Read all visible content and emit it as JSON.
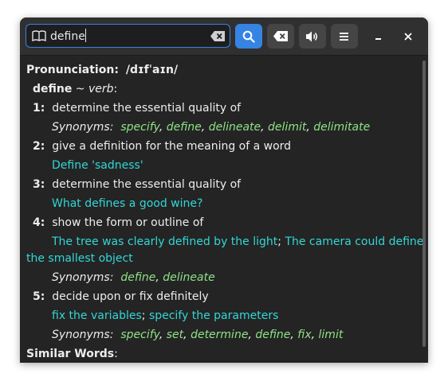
{
  "search": {
    "value": "define"
  },
  "pron": {
    "label": "Pronunciation",
    "text": "/dɪfˈaɪn/"
  },
  "entry": {
    "word": "define",
    "sep": " ~ ",
    "pos": "verb"
  },
  "colon": ":",
  "comma": ", ",
  "semicolon": "; ",
  "synonyms_label": "Synonyms:",
  "senses": [
    {
      "num": "1:",
      "text": "determine the essential quality of",
      "synonyms": [
        "specify",
        "define",
        "delineate",
        "delimit",
        "delimitate"
      ]
    },
    {
      "num": "2:",
      "text": "give a definition for the meaning of a word",
      "example": "Define 'sadness'"
    },
    {
      "num": "3:",
      "text": "determine the essential quality of",
      "example": "What defines a good wine?"
    },
    {
      "num": "4:",
      "text": "show the form or outline of",
      "examples": [
        "The tree was clearly defined by the light",
        "The camera could define",
        "the smallest object"
      ],
      "synonyms": [
        "define",
        "delineate"
      ]
    },
    {
      "num": "5:",
      "text": "decide upon or fix definitely",
      "examples": [
        "fix the variables",
        "specify the parameters"
      ],
      "synonyms": [
        "specify",
        "set",
        "determine",
        "define",
        "fix",
        "limit"
      ]
    }
  ],
  "similar": {
    "label": "Similar Words"
  },
  "colors": {
    "accent": "#3584e4",
    "synonym": "#8ee386",
    "example": "#33d6d6"
  },
  "icons": [
    "book-icon",
    "clear-text-icon",
    "search-icon",
    "backspace-icon",
    "speaker-icon",
    "menu-icon",
    "minimize-icon",
    "close-icon"
  ]
}
